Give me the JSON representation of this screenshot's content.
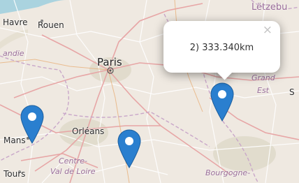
{
  "map": {
    "labels": {
      "letzebu": "Lëtzebu",
      "havre": "Havre",
      "rouen": "Rouen",
      "andie": "andie",
      "paris": "Paris",
      "grand_est_1": "Grand",
      "grand_est_2": "Est",
      "s": "S",
      "mans": "Mans",
      "orleans": "Orléans",
      "centre_1": "Centre-",
      "centre_2": "Val de Loire",
      "tours": "Tours",
      "bourgogne": "Bourgogne-"
    },
    "markers": [
      {
        "name": "marker-west",
        "color": "#2a7fcf"
      },
      {
        "name": "marker-south",
        "color": "#2a7fcf"
      },
      {
        "name": "marker-east",
        "color": "#2a7fcf"
      }
    ],
    "popup": {
      "text": "2) 333.340km",
      "close": "×"
    }
  },
  "colors": {
    "land": "#efe9e1",
    "road_major": "#e7a6a6",
    "road_minor": "#ffffff",
    "border": "#c9a7c9",
    "marker": "#2a7fcf"
  }
}
